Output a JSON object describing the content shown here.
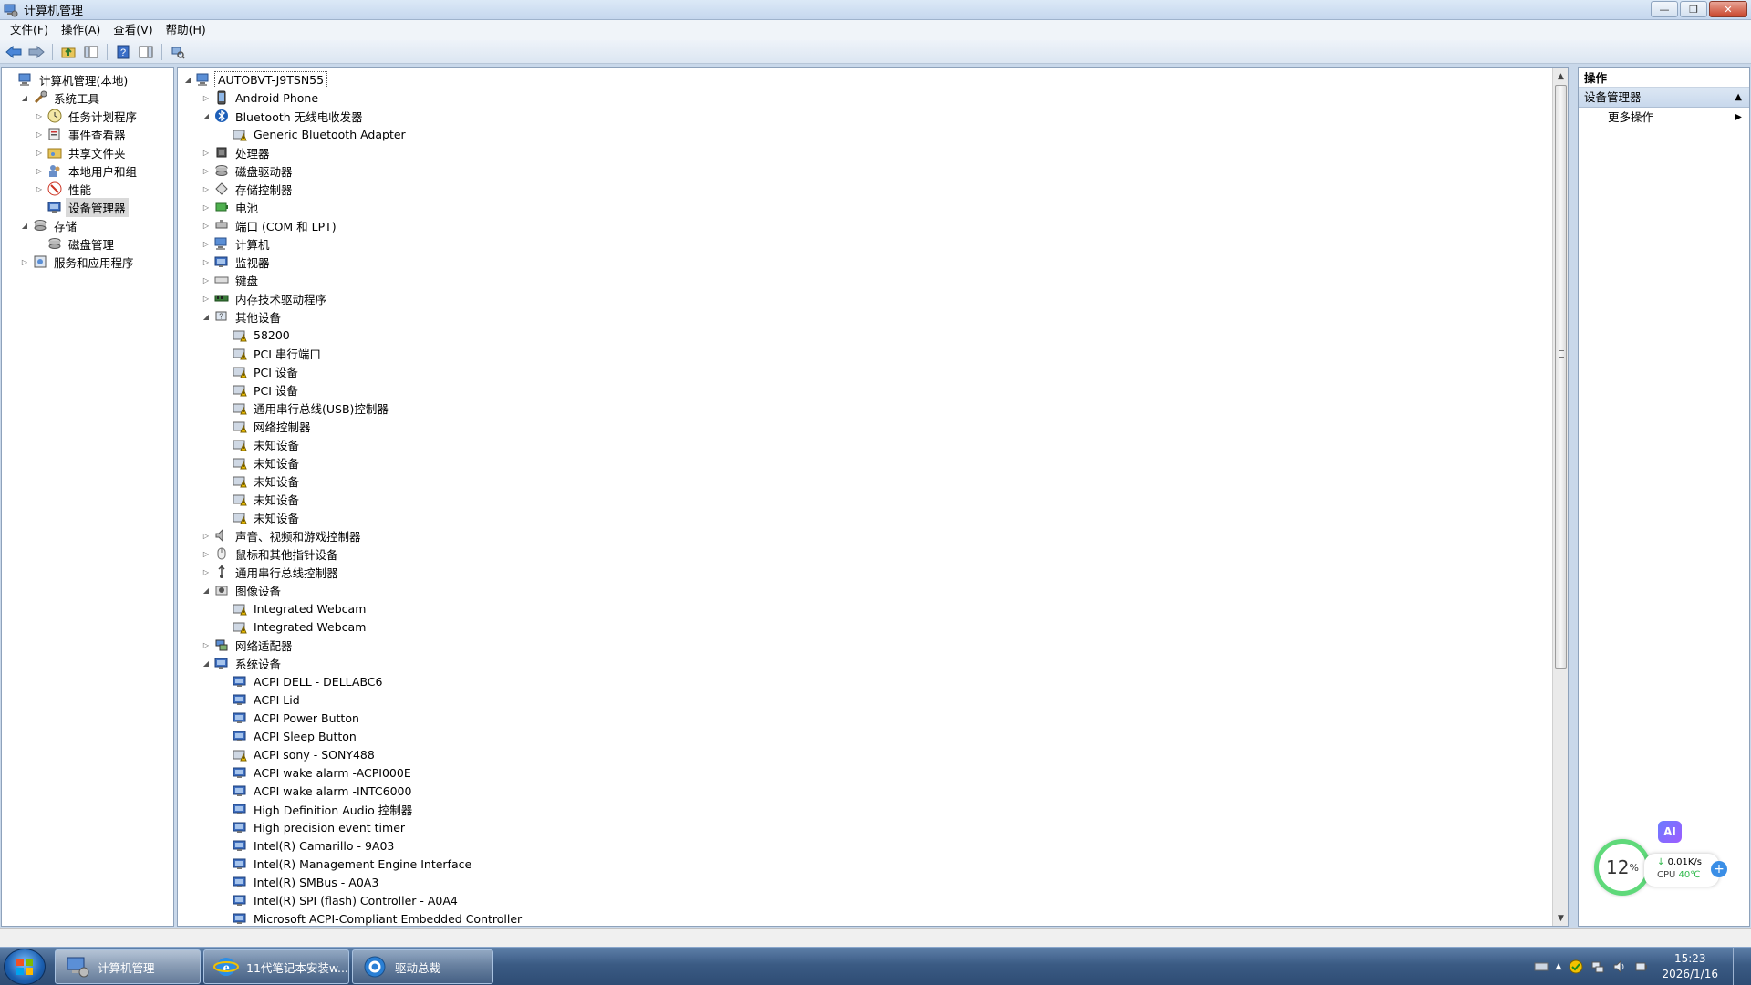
{
  "window": {
    "title": "计算机管理",
    "minimize": "—",
    "maximize": "❐",
    "close": "✕"
  },
  "menu": [
    "文件(F)",
    "操作(A)",
    "查看(V)",
    "帮助(H)"
  ],
  "left_tree": [
    {
      "label": "计算机管理(本地)",
      "indent": 0,
      "exp": "",
      "icon": "computer-management-icon"
    },
    {
      "label": "系统工具",
      "indent": 1,
      "exp": "◢",
      "icon": "tools-icon"
    },
    {
      "label": "任务计划程序",
      "indent": 2,
      "exp": "▷",
      "icon": "clock-icon"
    },
    {
      "label": "事件查看器",
      "indent": 2,
      "exp": "▷",
      "icon": "event-viewer-icon"
    },
    {
      "label": "共享文件夹",
      "indent": 2,
      "exp": "▷",
      "icon": "shared-folder-icon"
    },
    {
      "label": "本地用户和组",
      "indent": 2,
      "exp": "▷",
      "icon": "users-icon"
    },
    {
      "label": "性能",
      "indent": 2,
      "exp": "▷",
      "icon": "performance-icon"
    },
    {
      "label": "设备管理器",
      "indent": 2,
      "exp": "",
      "icon": "device-manager-icon",
      "selected": true
    },
    {
      "label": "存储",
      "indent": 1,
      "exp": "◢",
      "icon": "storage-icon"
    },
    {
      "label": "磁盘管理",
      "indent": 2,
      "exp": "",
      "icon": "disk-icon"
    },
    {
      "label": "服务和应用程序",
      "indent": 1,
      "exp": "▷",
      "icon": "services-icon"
    }
  ],
  "device_tree": [
    {
      "label": "AUTOBVT-J9TSN55",
      "indent": 0,
      "exp": "◢",
      "icon": "computer-icon",
      "root": true
    },
    {
      "label": "Android Phone",
      "indent": 1,
      "exp": "▷",
      "icon": "phone-icon"
    },
    {
      "label": "Bluetooth 无线电收发器",
      "indent": 1,
      "exp": "◢",
      "icon": "bluetooth-icon"
    },
    {
      "label": "Generic Bluetooth Adapter",
      "indent": 2,
      "exp": "",
      "icon": "bluetooth-warning-icon"
    },
    {
      "label": "处理器",
      "indent": 1,
      "exp": "▷",
      "icon": "processor-icon"
    },
    {
      "label": "磁盘驱动器",
      "indent": 1,
      "exp": "▷",
      "icon": "disk-drive-icon"
    },
    {
      "label": "存储控制器",
      "indent": 1,
      "exp": "▷",
      "icon": "storage-controller-icon"
    },
    {
      "label": "电池",
      "indent": 1,
      "exp": "▷",
      "icon": "battery-icon"
    },
    {
      "label": "端口 (COM 和 LPT)",
      "indent": 1,
      "exp": "▷",
      "icon": "port-icon"
    },
    {
      "label": "计算机",
      "indent": 1,
      "exp": "▷",
      "icon": "computer-icon"
    },
    {
      "label": "监视器",
      "indent": 1,
      "exp": "▷",
      "icon": "monitor-icon"
    },
    {
      "label": "键盘",
      "indent": 1,
      "exp": "▷",
      "icon": "keyboard-icon"
    },
    {
      "label": "内存技术驱动程序",
      "indent": 1,
      "exp": "▷",
      "icon": "memory-icon"
    },
    {
      "label": "其他设备",
      "indent": 1,
      "exp": "◢",
      "icon": "other-devices-icon"
    },
    {
      "label": "58200",
      "indent": 2,
      "exp": "",
      "icon": "warning-device-icon"
    },
    {
      "label": "PCI 串行端口",
      "indent": 2,
      "exp": "",
      "icon": "warning-device-icon"
    },
    {
      "label": "PCI 设备",
      "indent": 2,
      "exp": "",
      "icon": "warning-device-icon"
    },
    {
      "label": "PCI 设备",
      "indent": 2,
      "exp": "",
      "icon": "warning-device-icon"
    },
    {
      "label": "通用串行总线(USB)控制器",
      "indent": 2,
      "exp": "",
      "icon": "warning-device-icon"
    },
    {
      "label": "网络控制器",
      "indent": 2,
      "exp": "",
      "icon": "warning-device-icon"
    },
    {
      "label": "未知设备",
      "indent": 2,
      "exp": "",
      "icon": "warning-device-icon"
    },
    {
      "label": "未知设备",
      "indent": 2,
      "exp": "",
      "icon": "warning-device-icon"
    },
    {
      "label": "未知设备",
      "indent": 2,
      "exp": "",
      "icon": "warning-device-icon"
    },
    {
      "label": "未知设备",
      "indent": 2,
      "exp": "",
      "icon": "warning-device-icon"
    },
    {
      "label": "未知设备",
      "indent": 2,
      "exp": "",
      "icon": "warning-device-icon"
    },
    {
      "label": "声音、视频和游戏控制器",
      "indent": 1,
      "exp": "▷",
      "icon": "sound-icon"
    },
    {
      "label": "鼠标和其他指针设备",
      "indent": 1,
      "exp": "▷",
      "icon": "mouse-icon"
    },
    {
      "label": "通用串行总线控制器",
      "indent": 1,
      "exp": "▷",
      "icon": "usb-icon"
    },
    {
      "label": "图像设备",
      "indent": 1,
      "exp": "◢",
      "icon": "camera-icon"
    },
    {
      "label": "Integrated Webcam",
      "indent": 2,
      "exp": "",
      "icon": "webcam-warning-icon"
    },
    {
      "label": "Integrated Webcam",
      "indent": 2,
      "exp": "",
      "icon": "webcam-warning-icon"
    },
    {
      "label": "网络适配器",
      "indent": 1,
      "exp": "▷",
      "icon": "network-adapter-icon"
    },
    {
      "label": "系统设备",
      "indent": 1,
      "exp": "◢",
      "icon": "system-device-icon"
    },
    {
      "label": "ACPI DELL - DELLABC6",
      "indent": 2,
      "exp": "",
      "icon": "system-device-icon"
    },
    {
      "label": "ACPI Lid",
      "indent": 2,
      "exp": "",
      "icon": "system-device-icon"
    },
    {
      "label": "ACPI Power Button",
      "indent": 2,
      "exp": "",
      "icon": "system-device-icon"
    },
    {
      "label": "ACPI Sleep Button",
      "indent": 2,
      "exp": "",
      "icon": "system-device-icon"
    },
    {
      "label": "ACPI sony - SONY488",
      "indent": 2,
      "exp": "",
      "icon": "system-device-warning-icon"
    },
    {
      "label": "ACPI wake alarm -ACPI000E",
      "indent": 2,
      "exp": "",
      "icon": "system-device-icon"
    },
    {
      "label": "ACPI wake alarm -INTC6000",
      "indent": 2,
      "exp": "",
      "icon": "system-device-icon"
    },
    {
      "label": "High Definition Audio 控制器",
      "indent": 2,
      "exp": "",
      "icon": "system-device-icon"
    },
    {
      "label": "High precision event timer",
      "indent": 2,
      "exp": "",
      "icon": "system-device-icon"
    },
    {
      "label": "Intel(R) Camarillo - 9A03",
      "indent": 2,
      "exp": "",
      "icon": "system-device-icon"
    },
    {
      "label": "Intel(R) Management Engine Interface",
      "indent": 2,
      "exp": "",
      "icon": "system-device-icon"
    },
    {
      "label": "Intel(R) SMBus - A0A3",
      "indent": 2,
      "exp": "",
      "icon": "system-device-icon"
    },
    {
      "label": "Intel(R) SPI (flash) Controller - A0A4",
      "indent": 2,
      "exp": "",
      "icon": "system-device-icon"
    },
    {
      "label": "Microsoft ACPI-Compliant Embedded Controller",
      "indent": 2,
      "exp": "",
      "icon": "system-device-icon"
    }
  ],
  "actions": {
    "header": "操作",
    "section": "设备管理器",
    "more": "更多操作"
  },
  "gadget": {
    "ai": "AI",
    "cpu_percent": "12",
    "percent_sign": "%",
    "net": "0.01K/s",
    "cpu_label": "CPU",
    "temp": "40℃"
  },
  "taskbar": {
    "items": [
      "计算机管理",
      "11代笔记本安装w...",
      "驱动总裁"
    ],
    "time": "15:23",
    "date": "2026/1/16"
  },
  "colors": {
    "accent": "#3b5b84",
    "warning": "#f2c200",
    "selection": "#d9d9d9"
  }
}
